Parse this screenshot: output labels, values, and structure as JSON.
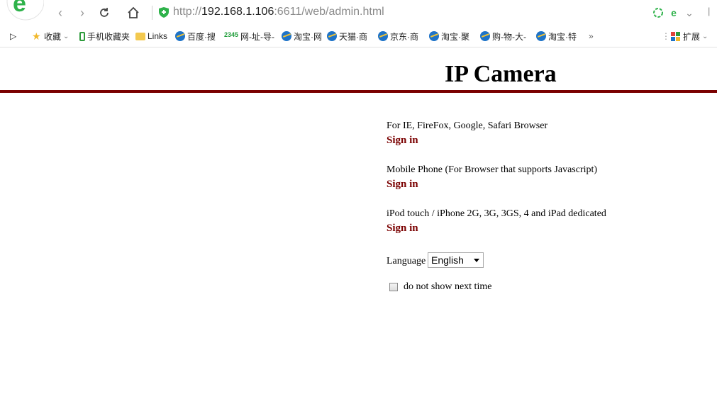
{
  "browser": {
    "url_scheme": "http://",
    "url_host": "192.168.1.106",
    "url_rest": ":6611/web/admin.html"
  },
  "bookmarks": [
    {
      "label": "收藏",
      "icon": "star-icon"
    },
    {
      "label": "手机收藏夹",
      "icon": "phone-icon"
    },
    {
      "label": "Links",
      "icon": "folder-icon"
    },
    {
      "label": "百度·搜",
      "icon": "ie-icon"
    },
    {
      "label": "网-址-导-",
      "icon": "2345-icon"
    },
    {
      "label": "淘宝·网",
      "icon": "ie-icon"
    },
    {
      "label": "天猫·商",
      "icon": "ie-icon"
    },
    {
      "label": "京东·商",
      "icon": "ie-icon"
    },
    {
      "label": "淘宝·聚",
      "icon": "ie-icon"
    },
    {
      "label": "购-物-大-",
      "icon": "ie-icon"
    },
    {
      "label": "淘宝·特",
      "icon": "ie-icon"
    }
  ],
  "bookmarks_more": "»",
  "extensions_label": "扩展",
  "page": {
    "title": "IP Camera",
    "sections": [
      {
        "description": "For IE, FireFox, Google, Safari Browser",
        "link": "Sign in"
      },
      {
        "description": "Mobile Phone (For Browser that supports Javascript)",
        "link": "Sign in"
      },
      {
        "description": "iPod touch / iPhone 2G, 3G, 3GS, 4 and iPad dedicated",
        "link": "Sign in"
      }
    ],
    "language_label": "Language",
    "language_value": "English",
    "checkbox_label": "do not show next time",
    "checkbox_checked": false
  },
  "colors": {
    "accent": "#7a0000",
    "browser_green": "#2eb24a"
  }
}
